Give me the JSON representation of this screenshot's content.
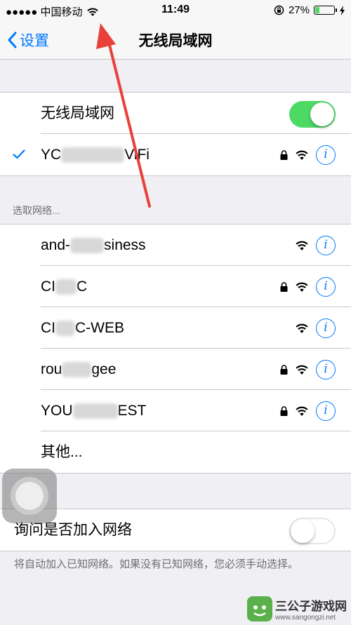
{
  "status_bar": {
    "carrier": "●●●●● 中国移动",
    "time": "11:49",
    "battery_percent": "27%",
    "battery_level": 0.27
  },
  "nav": {
    "back_label": "设置",
    "title": "无线局域网"
  },
  "wifi_toggle": {
    "label": "无线局域网",
    "on": true
  },
  "connected_network": {
    "name_prefix": "YC",
    "name_suffix": "ViFi",
    "locked": true,
    "checked": true
  },
  "section_label": "选取网络...",
  "networks": [
    {
      "prefix": "and-",
      "suffix": "siness",
      "locked": false
    },
    {
      "prefix": "CI",
      "suffix": "C",
      "locked": true
    },
    {
      "prefix": "CI",
      "suffix": "C-WEB",
      "locked": false
    },
    {
      "prefix": "rou",
      "suffix": "gee",
      "locked": true
    },
    {
      "prefix": "YOU",
      "suffix": "EST",
      "locked": true
    }
  ],
  "other_label": "其他...",
  "ask_join": {
    "label": "询问是否加入网络",
    "on": false
  },
  "footer_note": "将自动加入已知网络。如果没有已知网络，您必须手动选择。",
  "watermark": {
    "title": "三公子游戏网",
    "url": "www.sangongzi.net"
  },
  "colors": {
    "accent": "#007aff",
    "toggle_on": "#4cd964",
    "annotation_arrow": "#e8413a",
    "background": "#efeff4"
  }
}
